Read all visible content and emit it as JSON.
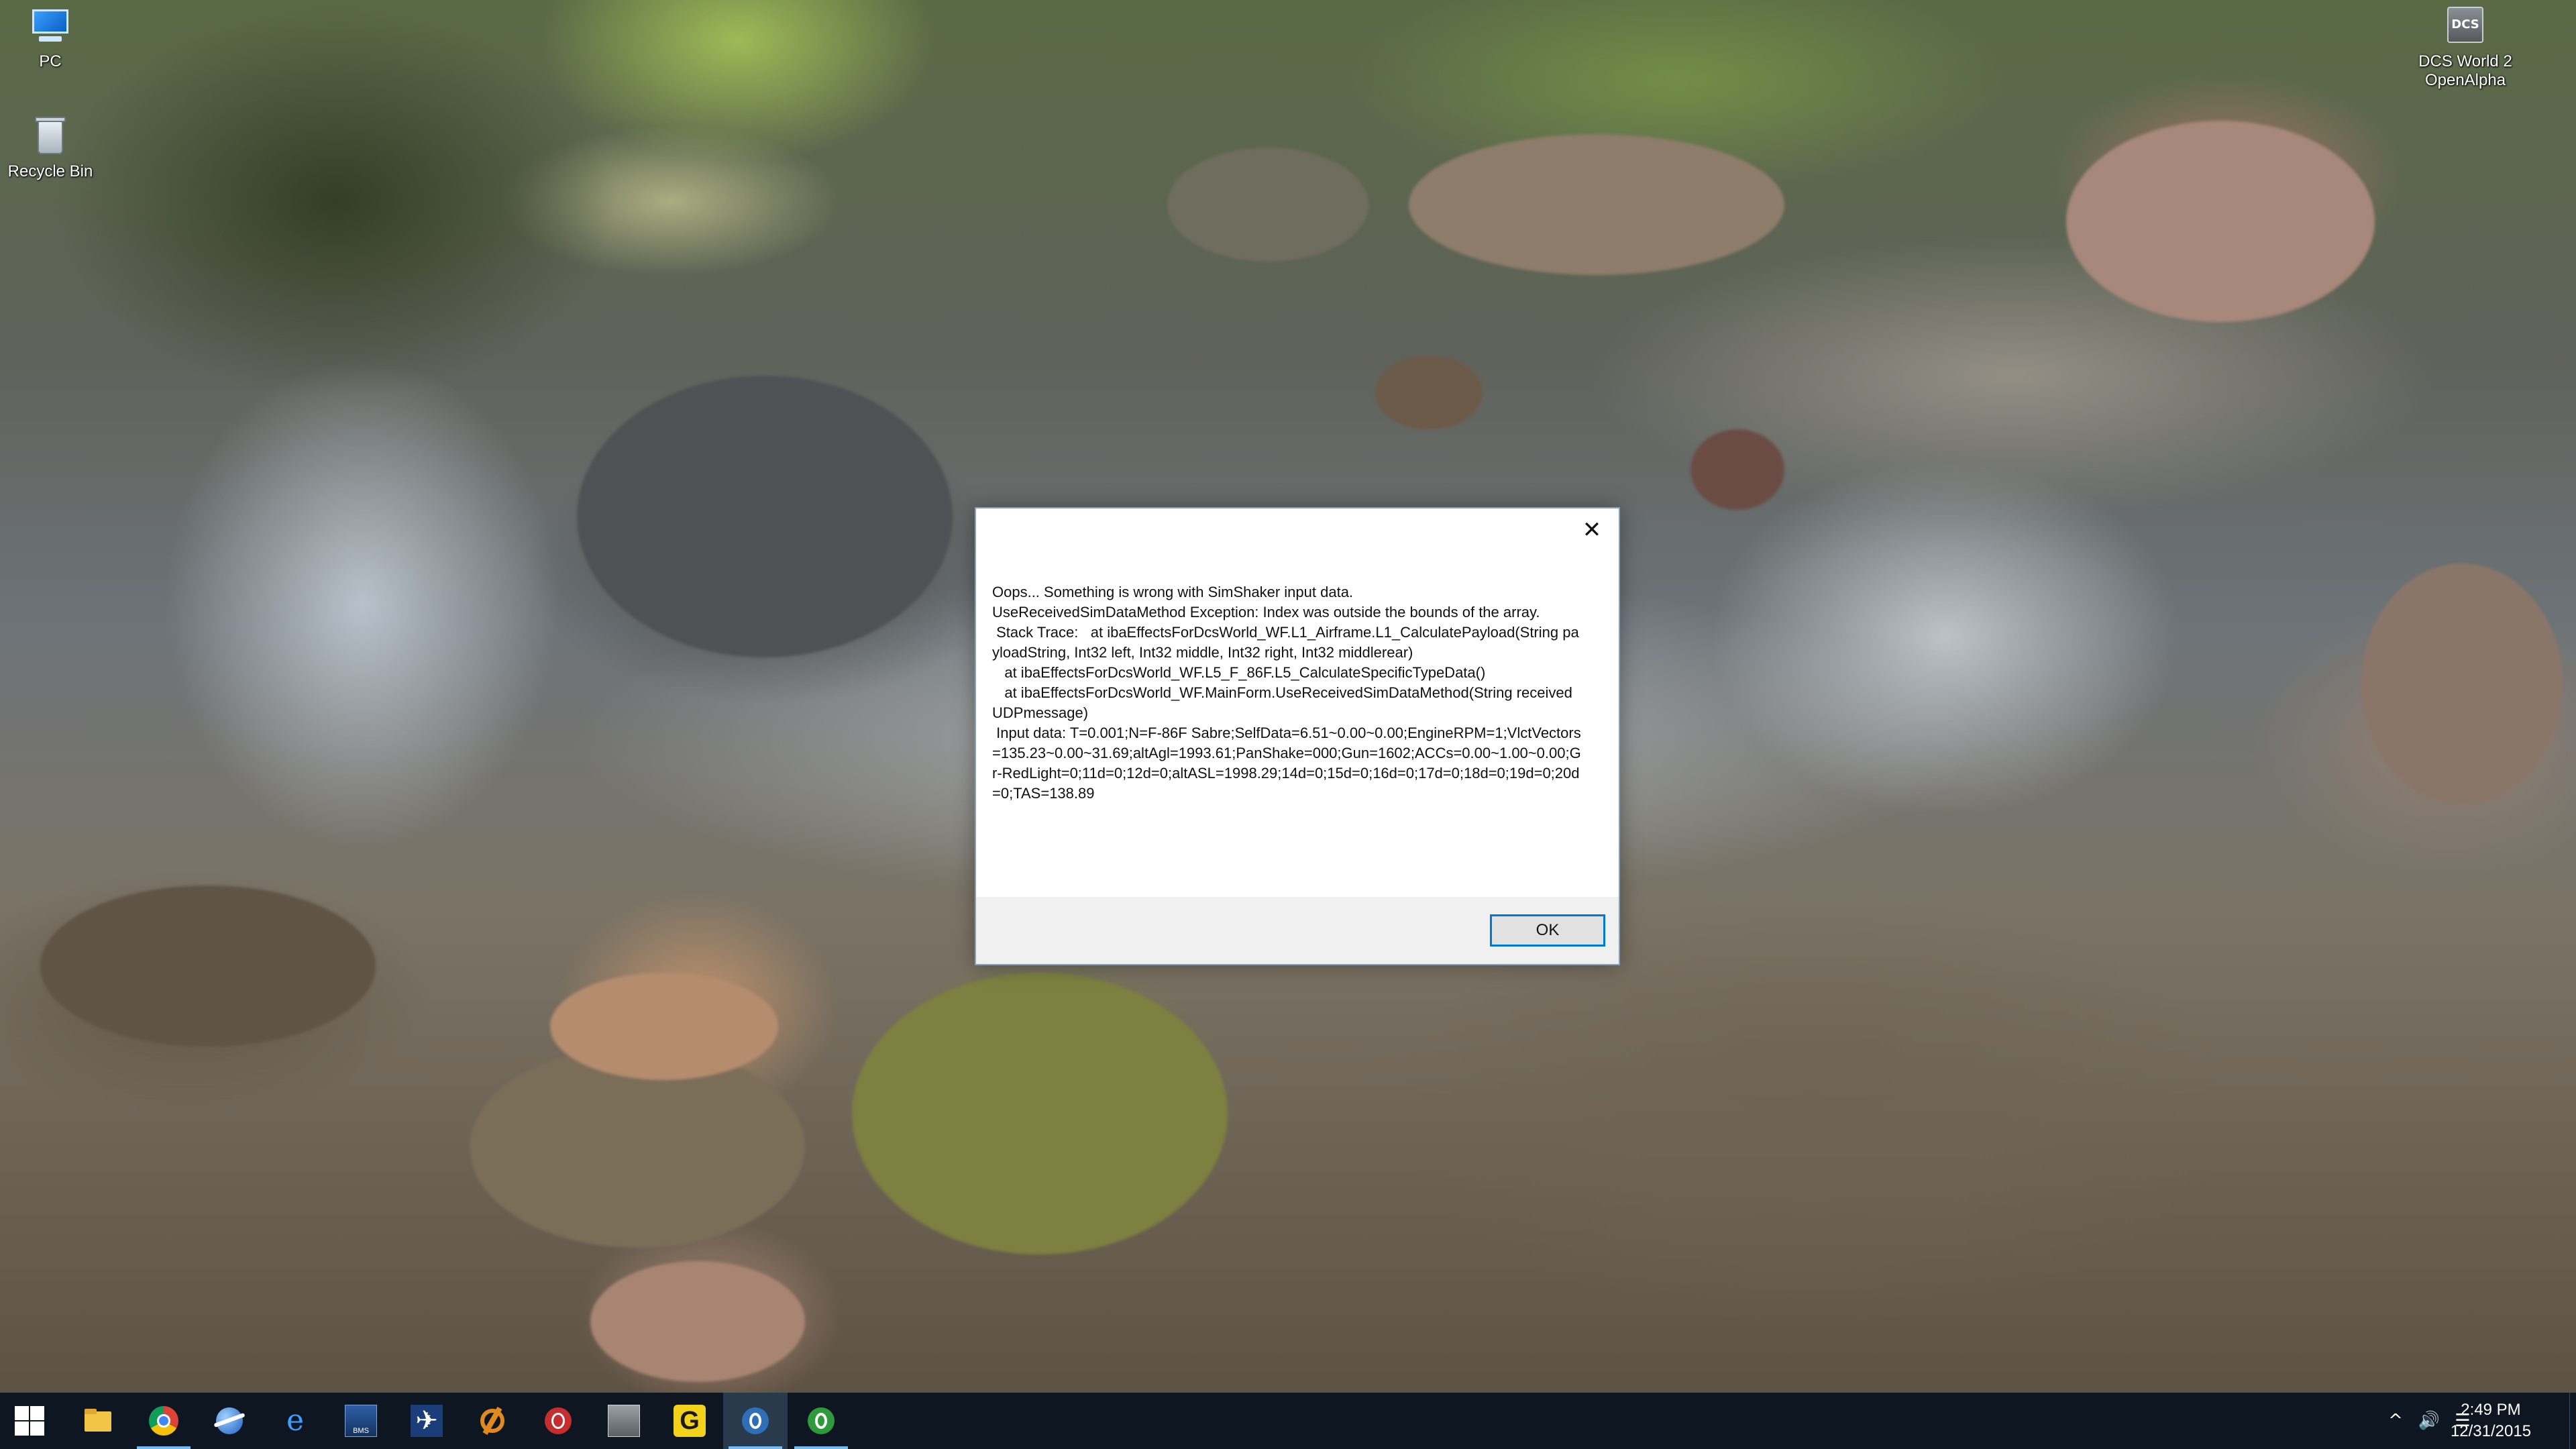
{
  "desktop": {
    "icons": [
      {
        "label": "PC",
        "icon": "computer-icon"
      },
      {
        "label": "Recycle Bin",
        "icon": "recycle-bin-icon"
      },
      {
        "label": "DCS World 2 OpenAlpha",
        "icon": "dcs-world-icon",
        "glyph": "DCS"
      }
    ]
  },
  "dialog": {
    "close_glyph": "✕",
    "message": "Oops... Something is wrong with SimShaker input data.\nUseReceivedSimDataMethod Exception: Index was outside the bounds of the array.\n Stack Trace:   at ibaEffectsForDcsWorld_WF.L1_Airframe.L1_CalculatePayload(String payloadString, Int32 left, Int32 middle, Int32 right, Int32 middlerear)\n   at ibaEffectsForDcsWorld_WF.L5_F_86F.L5_CalculateSpecificTypeData()\n   at ibaEffectsForDcsWorld_WF.MainForm.UseReceivedSimDataMethod(String receivedUDPmessage)\n Input data: T=0.001;N=F-86F Sabre;SelfData=6.51~0.00~0.00;EngineRPM=1;VlctVectors=135.23~0.00~31.69;altAgl=1993.61;PanShake=000;Gun=1602;ACCs=0.00~1.00~0.00;Gr-RedLight=0;11d=0;12d=0;altASL=1998.29;14d=0;15d=0;16d=0;17d=0;18d=0;19d=0;20d=0;TAS=138.89",
    "ok_label": "OK"
  },
  "taskbar": {
    "items": [
      {
        "name": "file-explorer",
        "icon": "folder-icon",
        "running": false
      },
      {
        "name": "chrome",
        "icon": "chrome-icon",
        "running": true
      },
      {
        "name": "globe-app",
        "icon": "globe-icon",
        "running": false
      },
      {
        "name": "edge",
        "icon": "edge-icon",
        "running": false
      },
      {
        "name": "bms",
        "icon": "bms-icon",
        "running": false,
        "glyph": "BMS"
      },
      {
        "name": "x-plane",
        "icon": "plane-x-icon",
        "running": false
      },
      {
        "name": "orange-app",
        "icon": "orange-gear-icon",
        "running": false
      },
      {
        "name": "red-app",
        "icon": "red-circle-icon",
        "running": false
      },
      {
        "name": "dcs",
        "icon": "dcs-icon",
        "running": false
      },
      {
        "name": "g-app",
        "icon": "g-logo-icon",
        "running": false,
        "glyph": "G"
      },
      {
        "name": "simshaker-blue",
        "icon": "simshaker-blue-icon",
        "running": true,
        "active": true
      },
      {
        "name": "simshaker-green",
        "icon": "simshaker-green-icon",
        "running": true
      }
    ],
    "tray": {
      "chevron": "^",
      "volume": "🔊",
      "notifications": "☰"
    },
    "clock": {
      "time": "2:49 PM",
      "date": "12/31/2015"
    }
  },
  "colors": {
    "accent": "#0078d7",
    "taskbar": "#0d1621",
    "dialog_footer": "#f0f0f0"
  }
}
